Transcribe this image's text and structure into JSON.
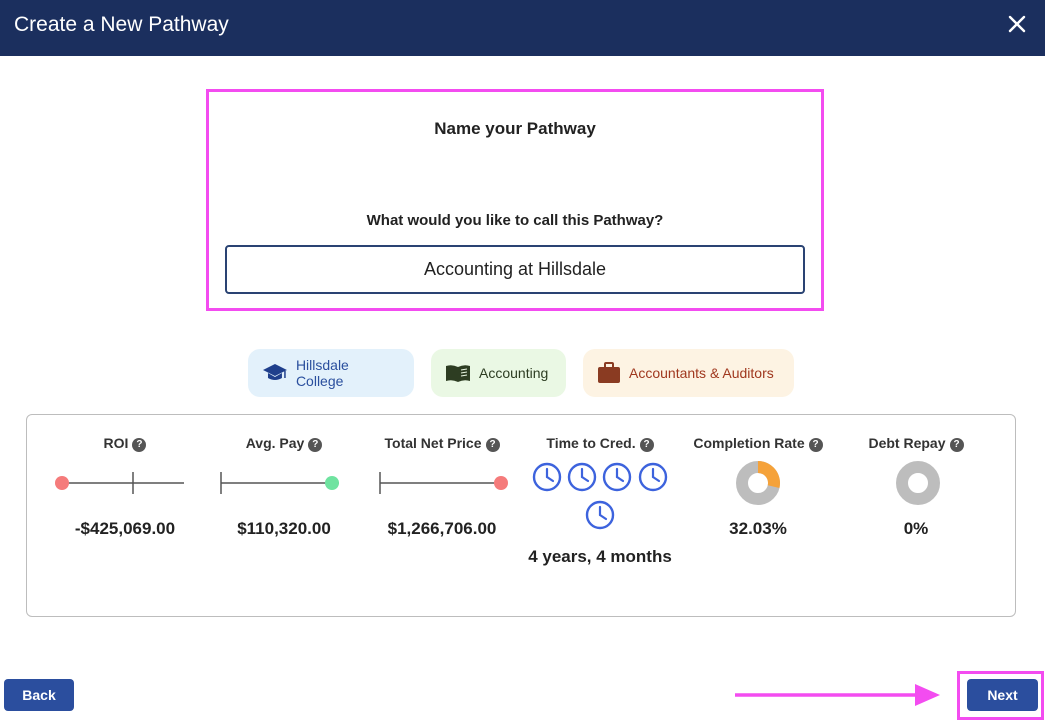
{
  "header": {
    "title": "Create a New Pathway",
    "close_icon": "close-icon"
  },
  "name_section": {
    "heading": "Name your Pathway",
    "question": "What would you like to call this Pathway?",
    "input_value": "Accounting at Hillsdale"
  },
  "tags": {
    "college": {
      "label": "Hillsdale College",
      "icon": "graduation-cap-icon",
      "color": "#2a4f9e"
    },
    "major": {
      "label": "Accounting",
      "icon": "book-icon",
      "color": "#2d3d22"
    },
    "career": {
      "label": "Accountants & Auditors",
      "icon": "briefcase-icon",
      "color": "#a0381f"
    }
  },
  "stats": {
    "roi": {
      "label": "ROI",
      "value": "-$425,069.00"
    },
    "avg_pay": {
      "label": "Avg. Pay",
      "value": "$110,320.00"
    },
    "total_net_price": {
      "label": "Total Net Price",
      "value": "$1,266,706.00"
    },
    "time_to_cred": {
      "label": "Time to Cred.",
      "value": "4 years, 4 months",
      "clock_count": 5
    },
    "completion_rate": {
      "label": "Completion Rate",
      "value": "32.03%",
      "fraction": 0.3203
    },
    "debt_repay": {
      "label": "Debt Repay",
      "value": "0%",
      "fraction": 0
    }
  },
  "footer": {
    "back_label": "Back",
    "next_label": "Next"
  },
  "colors": {
    "header_bg": "#1b2f5e",
    "highlight": "#f34cf0",
    "button": "#2b4e9e",
    "negative_marker": "#f57b7b",
    "positive_marker": "#6fe3a0",
    "completion_fill": "#f5a23a",
    "donut_gray": "#bdbdbd",
    "clock_blue": "#3d63dd"
  }
}
